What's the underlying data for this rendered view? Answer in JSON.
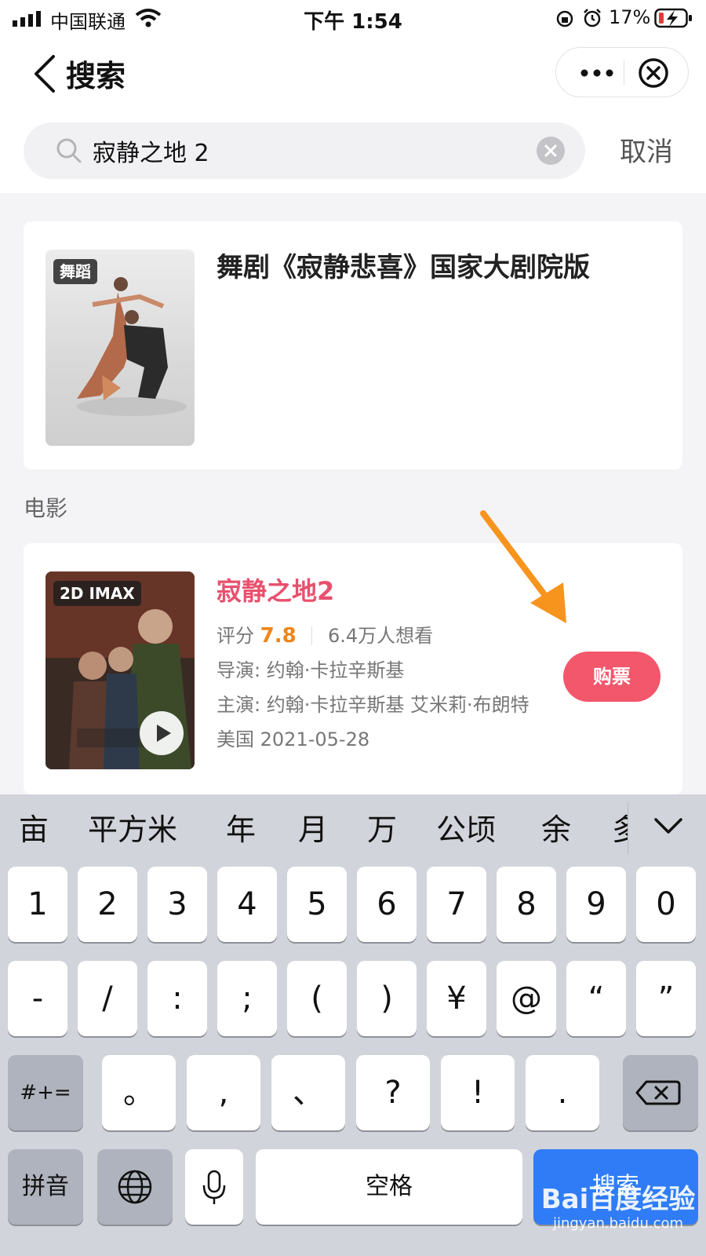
{
  "status_bar": {
    "carrier": "中国联通",
    "time": "下午 1:54",
    "battery_percent": "17%"
  },
  "nav": {
    "title": "搜索"
  },
  "search": {
    "query": "寂静之地 2",
    "cancel_label": "取消"
  },
  "results": {
    "show": {
      "tag": "舞蹈",
      "title": "舞剧《寂静悲喜》国家大剧院版"
    },
    "movie_section_label": "电影",
    "movie": {
      "tag": "2D IMAX",
      "title": "寂静之地2",
      "rating_label": "评分",
      "rating": "7.8",
      "want_to_see": "6.4万人想看",
      "director_label": "导演:",
      "director": "约翰·卡拉辛斯基",
      "cast_label": "主演:",
      "cast": "约翰·卡拉辛斯基 艾米莉·布朗特",
      "country": "美国",
      "release_date": "2021-05-28",
      "buy_label": "购票"
    }
  },
  "annotation": {
    "arrow_color": "#f7941d"
  },
  "keyboard": {
    "suggestions": [
      "亩",
      "平方米",
      "年",
      "月",
      "万",
      "公顷",
      "余",
      "多"
    ],
    "row1": [
      "1",
      "2",
      "3",
      "4",
      "5",
      "6",
      "7",
      "8",
      "9",
      "0"
    ],
    "row2": [
      "-",
      "/",
      ":",
      ";",
      "(",
      ")",
      "¥",
      "@",
      "“",
      "”"
    ],
    "row3_left": "#+=",
    "row3": [
      "。",
      ",",
      "、",
      "?",
      "!",
      "."
    ],
    "row4": {
      "pinyin": "拼音",
      "space": "空格",
      "enter": "搜索"
    }
  },
  "watermark": {
    "logo": "Bai百度经验",
    "url": "jingyan.baidu.com"
  }
}
